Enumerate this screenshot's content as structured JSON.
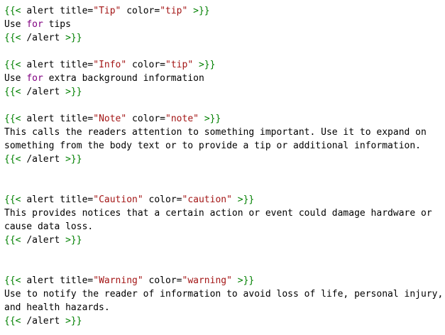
{
  "shortcode": {
    "open": "{{<",
    "close": ">}}",
    "name": "alert",
    "end_line": "/alert",
    "title_attr": "title=",
    "color_attr": "color="
  },
  "blocks": [
    {
      "title_value": "\"Tip\"",
      "color_value": "\"tip\"",
      "body": [
        {
          "parts": [
            {
              "t": "Use ",
              "k": "txt"
            },
            {
              "t": "for",
              "k": "kw"
            },
            {
              "t": " tips",
              "k": "txt"
            }
          ]
        }
      ]
    },
    {
      "title_value": "\"Info\"",
      "color_value": "\"tip\"",
      "body": [
        {
          "parts": [
            {
              "t": "Use ",
              "k": "txt"
            },
            {
              "t": "for",
              "k": "kw"
            },
            {
              "t": " extra background information",
              "k": "txt"
            }
          ]
        }
      ]
    },
    {
      "title_value": "\"Note\"",
      "color_value": "\"note\"",
      "body": [
        {
          "parts": [
            {
              "t": "This calls the readers attention to something important. Use it to expand on",
              "k": "txt"
            }
          ]
        },
        {
          "parts": [
            {
              "t": "something from the body text or to provide a tip or additional information.",
              "k": "txt"
            }
          ]
        }
      ]
    },
    {
      "title_value": "\"Caution\"",
      "color_value": "\"caution\"",
      "body": [
        {
          "parts": [
            {
              "t": "This provides notices that a certain action or event could damage hardware or",
              "k": "txt"
            }
          ]
        },
        {
          "parts": [
            {
              "t": "cause data loss.",
              "k": "txt"
            }
          ]
        }
      ]
    },
    {
      "title_value": "\"Warning\"",
      "color_value": "\"warning\"",
      "body": [
        {
          "parts": [
            {
              "t": "Use to notify the reader of information to avoid loss of life, personal injury,",
              "k": "txt"
            }
          ]
        },
        {
          "parts": [
            {
              "t": "and health hazards.",
              "k": "txt"
            }
          ]
        }
      ]
    }
  ],
  "colors": {
    "delimiter": "#008000",
    "string": "#a31515",
    "keyword": "#800080",
    "text": "#000000",
    "background": "#ffffff"
  }
}
